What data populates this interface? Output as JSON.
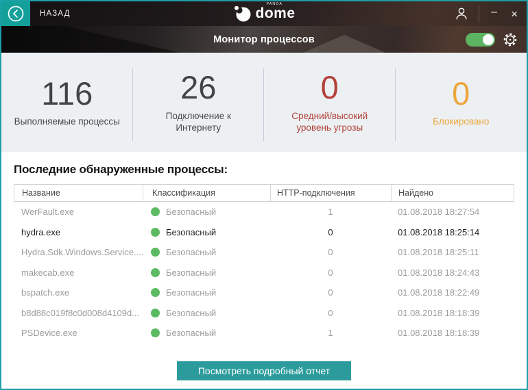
{
  "titlebar": {
    "back_label": "НАЗАД",
    "brand": "dome",
    "brand_small": "panda",
    "minimize_glyph": "–",
    "close_glyph": "×"
  },
  "subheader": {
    "title": "Монитор процессов",
    "toggle_state": "on"
  },
  "stats": [
    {
      "value": "116",
      "label": "Выполняемые процессы"
    },
    {
      "value": "26",
      "label": "Подключение к Интернету"
    },
    {
      "value": "0",
      "label": "Средний/высокий уровень угрозы"
    },
    {
      "value": "0",
      "label": "Блокировано"
    }
  ],
  "table": {
    "section_title": "Последние обнаруженные процессы:",
    "headers": [
      "Название",
      "Классификация",
      "HTTP-подключения",
      "Найдено"
    ],
    "rows": [
      {
        "name": "WerFault.exe",
        "classification": "Безопасный",
        "http": "1",
        "found": "01.08.2018 18:27:54",
        "highlight": false
      },
      {
        "name": "hydra.exe",
        "classification": "Безопасный",
        "http": "0",
        "found": "01.08.2018 18:25:14",
        "highlight": true
      },
      {
        "name": "Hydra.Sdk.Windows.Service....",
        "classification": "Безопасный",
        "http": "0",
        "found": "01.08.2018 18:25:11",
        "highlight": false
      },
      {
        "name": "makecab.exe",
        "classification": "Безопасный",
        "http": "0",
        "found": "01.08.2018 18:24:43",
        "highlight": false
      },
      {
        "name": "bspatch.exe",
        "classification": "Безопасный",
        "http": "0",
        "found": "01.08.2018 18:22:49",
        "highlight": false
      },
      {
        "name": "b8d88c019f8c0d008d4109d...",
        "classification": "Безопасный",
        "http": "0",
        "found": "01.08.2018 18:18:39",
        "highlight": false
      },
      {
        "name": "PSDevice.exe",
        "classification": "Безопасный",
        "http": "1",
        "found": "01.08.2018 18:18:39",
        "highlight": false
      }
    ]
  },
  "footer": {
    "report_button": "Посмотреть подробный отчет"
  },
  "colors": {
    "border_teal": "#1d9fa8",
    "accent_teal": "#14a09a",
    "button_teal": "#2b9c9b",
    "toggle_green": "#5cb462",
    "safe_green": "#5cba63",
    "threat_red": "#b2423b",
    "blocked_orange": "#eca63d"
  }
}
